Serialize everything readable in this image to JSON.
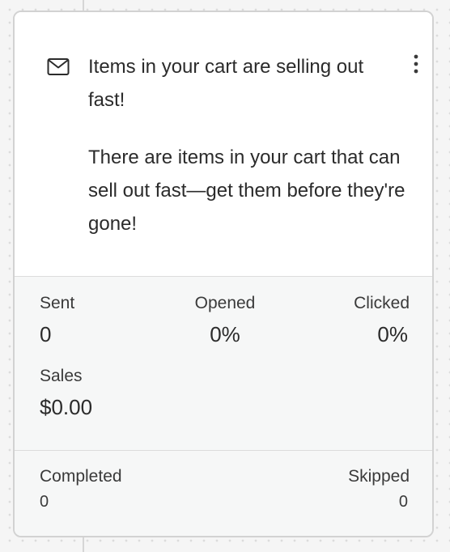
{
  "card": {
    "icon": "mail-icon",
    "title": "Items in your cart are selling out fast!",
    "body": "There are items in your cart that can sell out fast—get them before they're gone!",
    "menu_icon": "more-vertical-icon"
  },
  "stats": {
    "sent": {
      "label": "Sent",
      "value": "0"
    },
    "opened": {
      "label": "Opened",
      "value": "0%"
    },
    "clicked": {
      "label": "Clicked",
      "value": "0%"
    },
    "sales": {
      "label": "Sales",
      "value": "$0.00"
    }
  },
  "footer": {
    "completed": {
      "label": "Completed",
      "value": "0"
    },
    "skipped": {
      "label": "Skipped",
      "value": "0"
    }
  },
  "colors": {
    "card_background": "#ffffff",
    "stats_background": "#f6f7f7",
    "border": "#d2d2d2",
    "text": "#2b2b2b"
  }
}
